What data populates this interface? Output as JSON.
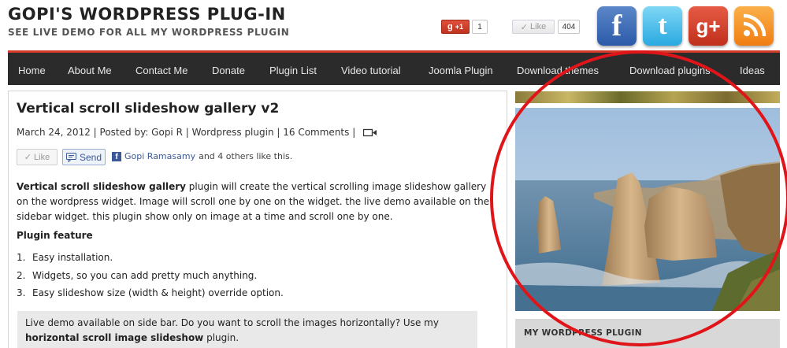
{
  "header": {
    "site_title": "GOPI'S WORDPRESS PLUG-IN",
    "tagline": "SEE LIVE DEMO FOR ALL MY WORDPRESS PLUGIN",
    "gplus_label": "+1",
    "gplus_count": "1",
    "fb_like_label": "Like",
    "fb_like_count": "404",
    "social_icons": [
      "facebook-icon",
      "twitter-icon",
      "google-plus-icon",
      "rss-icon"
    ]
  },
  "nav": {
    "items": [
      "Home",
      "About Me",
      "Contact Me",
      "Donate",
      "Plugin List",
      "Video tutorial",
      "Joomla Plugin",
      "Download themes",
      "Download plugins",
      "Ideas"
    ],
    "accent_color": "#d23a2a"
  },
  "post": {
    "title": "Vertical scroll slideshow gallery v2",
    "date": "March 24, 2012",
    "posted_by_label": "Posted by:",
    "author": "Gopi R",
    "category": "Wordpress plugin",
    "comments": "16 Comments",
    "like_label": "Like",
    "send_label": "Send",
    "fb_friend": "Gopi Ramasamy",
    "fb_others": "and 4 others like this.",
    "intro_bold": "Vertical scroll slideshow gallery",
    "intro_text": " plugin will create the vertical scrolling image slideshow gallery on the wordpress widget. Image will scroll one by one on the widget. the live demo available on the sidebar widget. this plugin show only on image at a time and scroll one by one.",
    "feature_heading": "Plugin feature",
    "features": [
      {
        "num": "1.",
        "text": "Easy installation."
      },
      {
        "num": "2.",
        "text": "Widgets, so you can add pretty much anything."
      },
      {
        "num": "3.",
        "text": "Easy slideshow size (width & height) override option."
      }
    ],
    "demo_note_text": "Live demo available on side bar. Do you want to scroll the images horizontally? Use my ",
    "demo_note_bold": "horizontal scroll image slideshow",
    "demo_note_end": " plugin."
  },
  "sidebar": {
    "widget_title": "MY WORDPRESS PLUGIN",
    "slide_image_subject": "coastal sea stacks"
  }
}
